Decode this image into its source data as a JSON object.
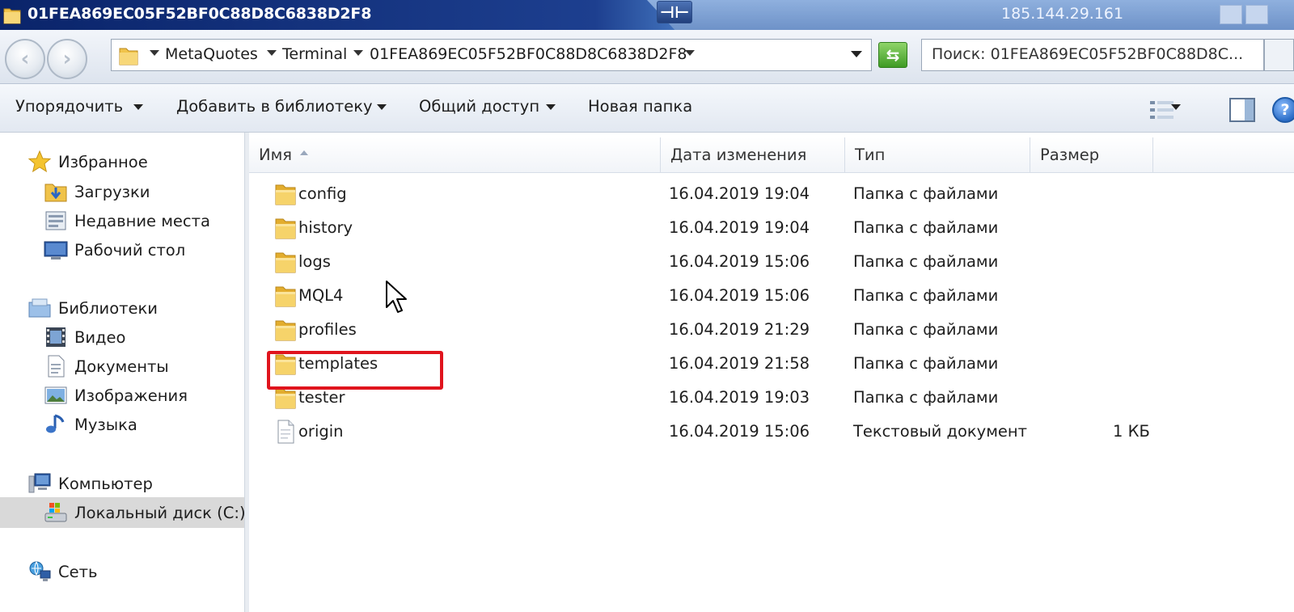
{
  "window": {
    "title": "01FEA869EC05F52BF0C88D8C6838D2F8",
    "remote_host": "185.144.29.161",
    "pin_label": "⊣⊢"
  },
  "address": {
    "breadcrumbs": [
      "MetaQuotes",
      "Terminal",
      "01FEA869EC05F52BF0C88D8C6838D2F8"
    ],
    "search_placeholder": "Поиск: 01FEA869EC05F52BF0C88D8C..."
  },
  "toolbar": {
    "organize": "Упорядочить",
    "add_to_library": "Добавить в библиотеку",
    "share": "Общий доступ",
    "new_folder": "Новая папка"
  },
  "sidebar": {
    "favorites": {
      "label": "Избранное",
      "items": [
        {
          "label": "Загрузки",
          "icon": "downloads-icon"
        },
        {
          "label": "Недавние места",
          "icon": "recent-places-icon"
        },
        {
          "label": "Рабочий стол",
          "icon": "desktop-icon"
        }
      ]
    },
    "libraries": {
      "label": "Библиотеки",
      "items": [
        {
          "label": "Видео",
          "icon": "video-icon"
        },
        {
          "label": "Документы",
          "icon": "documents-icon"
        },
        {
          "label": "Изображения",
          "icon": "pictures-icon"
        },
        {
          "label": "Музыка",
          "icon": "music-icon"
        }
      ]
    },
    "computer": {
      "label": "Компьютер",
      "items": [
        {
          "label": "Локальный диск (C:)",
          "icon": "local-disk-icon",
          "selected": true
        }
      ]
    },
    "network": {
      "label": "Сеть"
    }
  },
  "columns": {
    "name": "Имя",
    "modified": "Дата изменения",
    "type": "Тип",
    "size": "Размер"
  },
  "files": [
    {
      "name": "config",
      "modified": "16.04.2019 19:04",
      "type": "Папка с файлами",
      "size": "",
      "icon": "folder-icon"
    },
    {
      "name": "history",
      "modified": "16.04.2019 19:04",
      "type": "Папка с файлами",
      "size": "",
      "icon": "folder-icon"
    },
    {
      "name": "logs",
      "modified": "16.04.2019 15:06",
      "type": "Папка с файлами",
      "size": "",
      "icon": "folder-icon"
    },
    {
      "name": "MQL4",
      "modified": "16.04.2019 15:06",
      "type": "Папка с файлами",
      "size": "",
      "icon": "folder-icon"
    },
    {
      "name": "profiles",
      "modified": "16.04.2019 21:29",
      "type": "Папка с файлами",
      "size": "",
      "icon": "folder-icon"
    },
    {
      "name": "templates",
      "modified": "16.04.2019 21:58",
      "type": "Папка с файлами",
      "size": "",
      "icon": "folder-icon",
      "highlighted": true
    },
    {
      "name": "tester",
      "modified": "16.04.2019 19:03",
      "type": "Папка с файлами",
      "size": "",
      "icon": "folder-icon"
    },
    {
      "name": "origin",
      "modified": "16.04.2019 15:06",
      "type": "Текстовый документ",
      "size": "1 КБ",
      "icon": "text-file-icon"
    }
  ],
  "colors": {
    "highlight_border": "#e0141d",
    "selected_nav_bg": "#d9d9d9",
    "folder_yellow": "#f0c34a"
  }
}
